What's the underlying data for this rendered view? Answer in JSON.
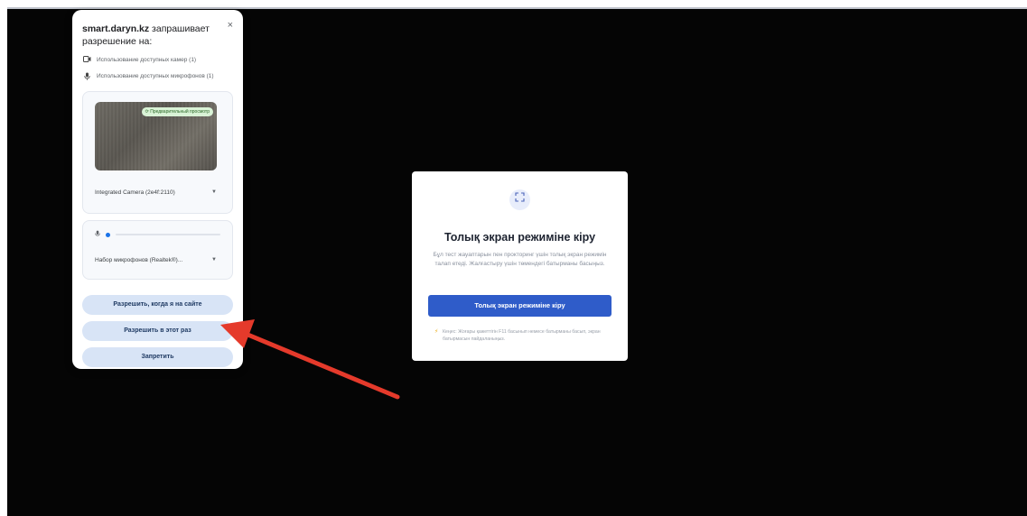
{
  "permission_popup": {
    "site": "smart.daryn.kz",
    "title_rest": " запрашивает разрешение на:",
    "close_glyph": "×",
    "camera_permission": "Использование доступных камер (1)",
    "microphone_permission": "Использование доступных микрофонов (1)",
    "camera_status_badge": "⟳ Предварительный просмотр",
    "camera_select_value": "Integrated Camera (2e4f:2110)",
    "microphone_select_value": "Набор микрофонов (Realtek®)...",
    "buttons": {
      "allow_on_site": "Разрешить, когда я на сайте",
      "allow_once": "Разрешить в этот раз",
      "deny": "Запретить"
    }
  },
  "fullscreen_dialog": {
    "icon": "expand-icon",
    "title": "Толық экран режиміне кіру",
    "description": "Бұл тест жауаптарын пен прокторинг үшін толық экран режимін талап етеді. Жалғастыру үшін төмендегі батырманы басыңыз.",
    "button_label": "Толық экран режиміне кіру",
    "note": "Кеңес: Жоғары қажеттігін F11 басынып немесе батырманы басып, экран батырмасын пайдаланыңыз."
  },
  "colors": {
    "screen_bg": "#050505",
    "primary": "#2f5cc9",
    "permission_button_bg": "#d8e4f6",
    "arrow": "#e53a2b"
  }
}
